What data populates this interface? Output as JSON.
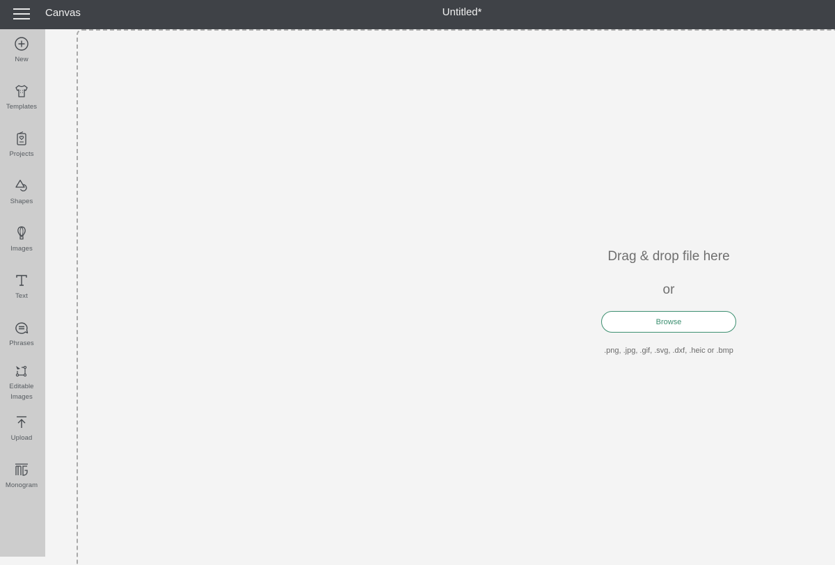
{
  "header": {
    "app_name": "Canvas",
    "document_title": "Untitled*",
    "menu_icon": "hamburger-menu-icon"
  },
  "sidebar": {
    "items": [
      {
        "id": "new",
        "label": "New",
        "icon": "plus-circle-icon"
      },
      {
        "id": "templates",
        "label": "Templates",
        "icon": "tshirt-icon"
      },
      {
        "id": "projects",
        "label": "Projects",
        "icon": "card-heart-icon"
      },
      {
        "id": "shapes",
        "label": "Shapes",
        "icon": "shapes-icon"
      },
      {
        "id": "images",
        "label": "Images",
        "icon": "hot-air-balloon-icon"
      },
      {
        "id": "text",
        "label": "Text",
        "icon": "text-t-icon"
      },
      {
        "id": "phrases",
        "label": "Phrases",
        "icon": "speech-bubble-icon"
      },
      {
        "id": "editable-images",
        "label": "Editable Images",
        "label_line1": "Editable",
        "label_line2": "Images",
        "icon": "editable-node-icon"
      },
      {
        "id": "upload",
        "label": "Upload",
        "icon": "upload-arrow-icon"
      },
      {
        "id": "monogram",
        "label": "Monogram",
        "icon": "monogram-icon"
      }
    ]
  },
  "upload_panel": {
    "title": "Drag & drop file here",
    "or_text": "or",
    "browse_label": "Browse",
    "file_types": ".png, .jpg, .gif, .svg, .dxf, .heic or .bmp"
  },
  "colors": {
    "topbar": "#3f4247",
    "sidebar": "#cdcdcd",
    "canvas": "#f4f4f4",
    "accent_green": "#3c8f70"
  }
}
